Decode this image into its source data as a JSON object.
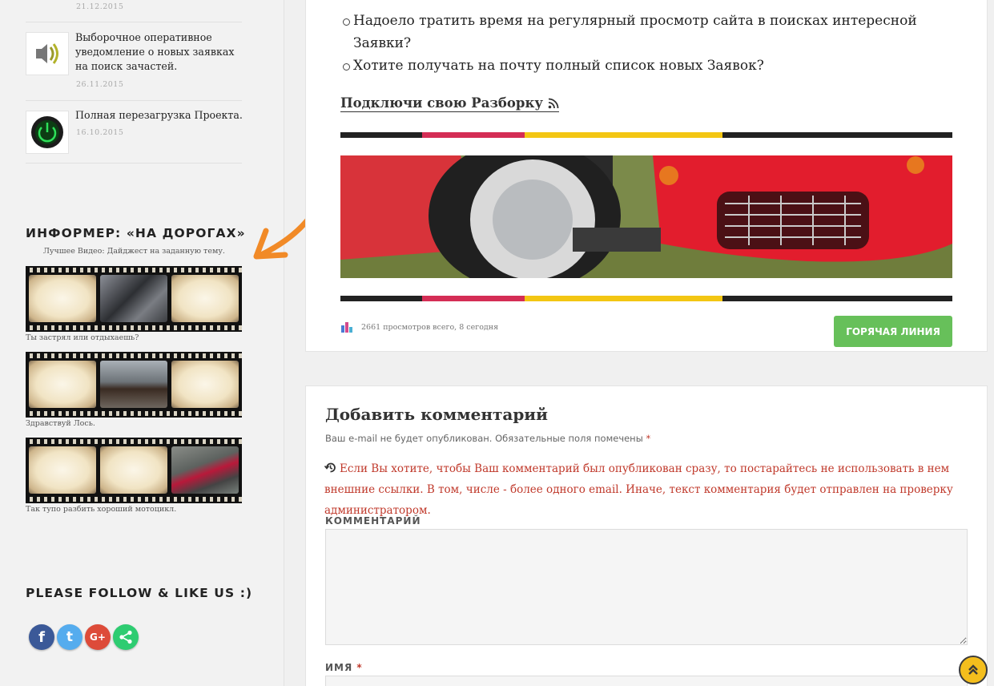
{
  "sidebar": {
    "recent_posts": [
      {
        "title": "",
        "date": "21.12.2015",
        "icon": "post-icon"
      },
      {
        "title": "Выборочное оперативное уведомление о новых заявках на поиск зачастей.",
        "date": "26.11.2015",
        "icon": "bell-sound-icon"
      },
      {
        "title": "Полная перезагрузка Проекта.",
        "date": "16.10.2015",
        "icon": "power-icon"
      }
    ],
    "informer": {
      "title": "ИНФОРМЕР: «НА ДОРОГАХ»",
      "subtitle": "Лучшее Видео: Дайджест на заданную тему.",
      "videos": [
        {
          "caption": "Ты застрял или отдыхаешь?"
        },
        {
          "caption": "Здравствуй Лось."
        },
        {
          "caption": "Так тупо разбить хороший мотоцикл."
        }
      ]
    },
    "follow": {
      "title": "PLEASE FOLLOW & LIKE US :)",
      "buttons": [
        {
          "icon": "facebook-icon",
          "glyph": "f",
          "color": "#3b5998"
        },
        {
          "icon": "twitter-icon",
          "glyph": "t",
          "color": "#55acee"
        },
        {
          "icon": "google-plus-icon",
          "glyph": "G+",
          "color": "#dd4b39"
        },
        {
          "icon": "share-icon",
          "glyph": "<",
          "color": "#2ecc71"
        }
      ]
    }
  },
  "main": {
    "bullets": [
      "Надоело тратить время на регулярный просмотр сайта в поисках интересной Заявки?",
      "Хотите получать на почту полный список новых Заявок?"
    ],
    "subscribe_link": "Подключи свою Разборку",
    "stripe_colors": [
      "#222222",
      "#d42d55",
      "#f3c613",
      "#222222"
    ],
    "stats": "2661 просмотров всего, 8 сегодня",
    "hotline_button": "ГОРЯЧАЯ ЛИНИЯ",
    "hotline_color": "#67c05a"
  },
  "comment_form": {
    "title": "Добавить комментарий",
    "notes": "Ваш e-mail не будет опубликован. Обязательные поля помечены",
    "required_mark": "*",
    "warning": "Если Вы хотите, чтобы Ваш комментарий был опубликован сразу, то постарайтесь не использовать в нем внешние ссылки. В том, числе - более одного email. Иначе, текст комментария будет отправлен на проверку администратором.",
    "comment_label": "КОММЕНТАРИЙ",
    "name_label": "ИМЯ"
  },
  "accent_color": "#f4be1d"
}
